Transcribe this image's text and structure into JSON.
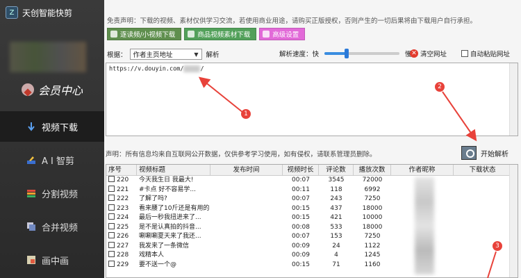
{
  "app": {
    "title": "天创智能快剪",
    "logo_text": "Z"
  },
  "sidebar": {
    "member_label": "会员中心",
    "items": [
      {
        "label": "视频下载",
        "active": true,
        "icon": "download-arrow-icon"
      },
      {
        "label": "A I 智剪",
        "active": false,
        "icon": "ai-edit-icon"
      },
      {
        "label": "分割视频",
        "active": false,
        "icon": "split-video-icon"
      },
      {
        "label": "合并视频",
        "active": false,
        "icon": "merge-video-icon"
      },
      {
        "label": "画中画",
        "active": false,
        "icon": "picture-in-picture-icon"
      }
    ]
  },
  "header": {
    "disclaimer": "免责声明：下载的视频、素材仅供学习交流，若使用商业用途，请购买正版授权，否则产生的一切后果将由下载用户自行承担。"
  },
  "toolbar": {
    "buttons": [
      {
        "label": "逐读频/小视频下载",
        "color": "#5f8f4e"
      },
      {
        "label": "商品视频素材下载",
        "color": "#52a05a"
      },
      {
        "label": "高级设置",
        "color": "#e26ad8"
      }
    ]
  },
  "options": {
    "mode_label": "根据：",
    "mode_value": "作者主页地址",
    "parse_label": "解析",
    "speed_label": "解析速度：快",
    "speed_slow": "慢",
    "speed_position": 0.3,
    "clear_label": "清空网址",
    "auto_paste_label": "自动粘贴网址"
  },
  "url_input": {
    "value": "https://v.douyin.com/",
    "suffix": "/"
  },
  "notice": "声明：所有信息均来自互联网公开数据，仅供参考学习使用，如有侵权，请联系管理员删除。",
  "parse_button": "开始解析",
  "table": {
    "headers": [
      "序号",
      "视频标题",
      "发布时间",
      "视频时长",
      "评论数",
      "播放次数",
      "作者昵称",
      "下载状态"
    ],
    "rows": [
      {
        "no": "220",
        "title": "今天我生日 我最大!",
        "time": "",
        "duration": "00:07",
        "comments": "3545",
        "plays": "72000"
      },
      {
        "no": "221",
        "title": "#卡点    好不容易学...",
        "time": "",
        "duration": "00:11",
        "comments": "118",
        "plays": "6992"
      },
      {
        "no": "222",
        "title": "了解了吗?",
        "time": "",
        "duration": "00:07",
        "comments": "243",
        "plays": "7250"
      },
      {
        "no": "223",
        "title": "看来腰了10斤还是有用的",
        "time": "",
        "duration": "00:15",
        "comments": "437",
        "plays": "18000"
      },
      {
        "no": "224",
        "title": "最后一秒我扭进来了...",
        "time": "",
        "duration": "00:15",
        "comments": "421",
        "plays": "10000"
      },
      {
        "no": "225",
        "title": "是不是认真拍的抖音...",
        "time": "",
        "duration": "00:08",
        "comments": "533",
        "plays": "18000"
      },
      {
        "no": "226",
        "title": "唰唰唰夏天来了我还...",
        "time": "",
        "duration": "00:07",
        "comments": "153",
        "plays": "7250"
      },
      {
        "no": "227",
        "title": "我发来了一条微信",
        "time": "",
        "duration": "00:09",
        "comments": "24",
        "plays": "1122"
      },
      {
        "no": "228",
        "title": "戏精本人",
        "time": "",
        "duration": "00:09",
        "comments": "4",
        "plays": "1245"
      },
      {
        "no": "229",
        "title": "要不送一个@",
        "time": "",
        "duration": "00:15",
        "comments": "71",
        "plays": "1160"
      }
    ]
  },
  "annotations": [
    "1",
    "2",
    "3"
  ],
  "colors": {
    "sidebar": "#333333",
    "accent": "#e8423a",
    "slider": "#2c7ad8"
  }
}
